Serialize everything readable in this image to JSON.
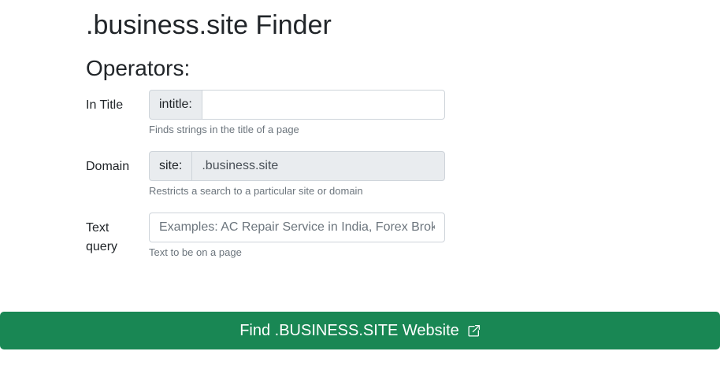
{
  "page": {
    "title": ".business.site Finder",
    "subtitle": "Operators:"
  },
  "fields": {
    "intitle": {
      "label": "In Title",
      "prefix": "intitle:",
      "value": "",
      "placeholder": "",
      "help": "Finds strings in the title of a page"
    },
    "domain": {
      "label": "Domain",
      "prefix": "site:",
      "value": ".business.site",
      "help": "Restricts a search to a particular site or domain"
    },
    "text_query": {
      "label": "Text query",
      "value": "",
      "placeholder": "Examples: AC Repair Service in India, Forex Broker",
      "help": "Text to be on a page"
    }
  },
  "action": {
    "label": "Find .BUSINESS.SITE Website",
    "icon": "external-link-icon",
    "color": "#198754"
  }
}
